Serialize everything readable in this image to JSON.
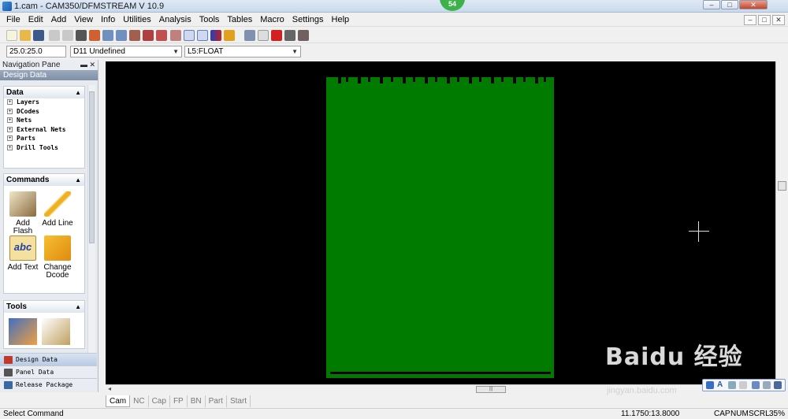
{
  "window": {
    "title": "1.cam - CAM350/DFMSTREAM V 10.9",
    "badge": "54",
    "min_glyph": "–",
    "max_glyph": "□",
    "close_glyph": "✕"
  },
  "menu": [
    "File",
    "Edit",
    "Add",
    "View",
    "Info",
    "Utilities",
    "Analysis",
    "Tools",
    "Tables",
    "Macro",
    "Settings",
    "Help"
  ],
  "combos": {
    "grid": "25.0:25.0",
    "dcode": "D11  Undefined",
    "layer": "L5:FLOAT"
  },
  "nav": {
    "header": "Navigation Pane",
    "design_data_title": "Design Data",
    "data_panel": {
      "title": "Data",
      "items": [
        "Layers",
        "DCodes",
        "Nets",
        "External Nets",
        "Parts",
        "Drill Tools"
      ]
    },
    "commands_panel": {
      "title": "Commands",
      "items": [
        "Add Flash",
        "Add Line",
        "Add Text",
        "Change Dcode"
      ]
    },
    "tools_panel": {
      "title": "Tools"
    },
    "tabs": [
      "Design Data",
      "Panel Data",
      "Release Package"
    ]
  },
  "editor_tabs": [
    "Cam",
    "NC",
    "Cap",
    "FP",
    "BN",
    "Part",
    "Start"
  ],
  "status": {
    "message": "Select Command",
    "coords": "11.1750:13.8000",
    "cap": "CAP",
    "num": "NUM",
    "scrl": "SCRL",
    "zoom": "35%"
  },
  "watermark": {
    "text": "Baidu 经验",
    "url": "jingyan.baidu.com"
  },
  "colors": {
    "canvas_bg": "#000000",
    "board": "#007b00"
  }
}
